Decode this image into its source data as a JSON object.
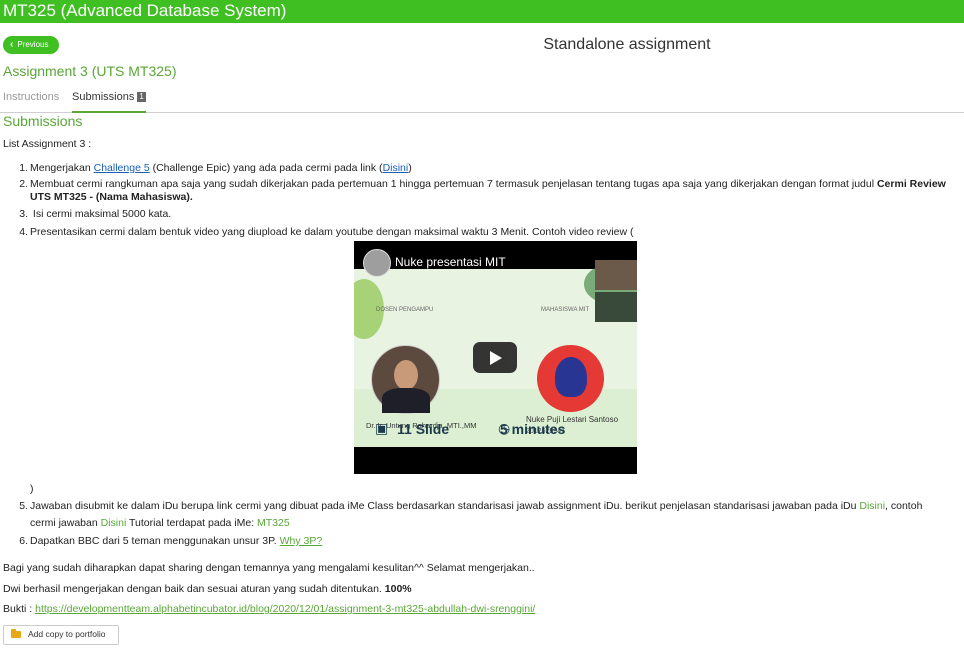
{
  "app": {
    "title": "MT325 (Advanced Database System)"
  },
  "nav": {
    "previous_label": "Previous",
    "page_title": "Standalone assignment"
  },
  "assignment": {
    "title": "Assignment 3 (UTS MT325)"
  },
  "tabs": [
    {
      "label": "Instructions",
      "active": false
    },
    {
      "label": "Submissions",
      "badge": "1",
      "active": true
    }
  ],
  "section": {
    "title": "Submissions"
  },
  "content": {
    "intro": "List Assignment 3 :",
    "items": [
      {
        "num": "1.",
        "pre": "Mengerjakan ",
        "link1": "Challenge 5",
        "mid": " (Challenge Epic) yang ada pada cermi pada link (",
        "link2": "Disini",
        "post": ")"
      },
      {
        "num": "2.",
        "line1_pre": "Membuat cermi rangkuman apa saja yang sudah dikerjakan pada pertemuan 1 hingga pertemuan 7 termasuk penjelasan tentang tugas apa saja yang dikerjakan dengan format judul ",
        "line1_bold": "Cermi Review",
        "line2_bold": "UTS MT325 - (Nama Mahasiswa)."
      },
      {
        "num": "3.",
        "text": " Isi cermi maksimal 5000 kata."
      },
      {
        "num": "4.",
        "text": "Presentasikan cermi dalam bentuk video yang diupload ke dalam youtube dengan maksimal waktu 3 Menit. Contoh video review (",
        "closing": ")"
      },
      {
        "num": "5.",
        "line1_pre": "Jawaban disubmit ke dalam iDu berupa link cermi yang dibuat pada iMe Class berdasarkan standarisasi jawab assignment iDu. berikut penjelasan standarisasi jawaban pada iDu ",
        "line1_link": "Disini",
        "line1_post": ", contoh",
        "line2_pre": "cermi jawaban ",
        "line2_link": "Disini",
        "line2_mid": " Tutorial terdapat pada iMe: ",
        "line2_link2": "MT325"
      },
      {
        "num": "6.",
        "pre": "Dapatkan BBC dari 5 teman menggunakan unsur 3P. ",
        "link": "Why 3P?"
      }
    ],
    "video": {
      "title": "Nuke presentasi MIT",
      "dosen_label": "DOSEN PENGAMPU",
      "mahasiswa_label": "MAHASISWA MIT",
      "dosen_name": "Dr. Ir. Untung Rahardja, MTI.,MM",
      "student_name": "Nuke Puji Lestari Santoso",
      "student_id": "2012529947",
      "slides": "11 Slide",
      "duration": "5 minutes"
    },
    "closing": "Bagi yang sudah diharapkan dapat sharing dengan temannya yang mengalami kesulitan^^ Selamat mengerjakan..",
    "result_pre": "Dwi berhasil mengerjakan dengan baik dan sesuai aturan yang sudah ditentukan. ",
    "result_bold": "100%",
    "bukti_label": "Bukti : ",
    "bukti_link": "https://developmentteam.alphabetincubator.id/blog/2020/12/01/assignment-3-mt325-abdullah-dwi-srenggini/"
  },
  "actions": {
    "portfolio_label": "Add copy to portfolio"
  },
  "colors": {
    "accent": "#3fbf21",
    "green_text": "#5aa638",
    "link": "#1a5fb4"
  }
}
